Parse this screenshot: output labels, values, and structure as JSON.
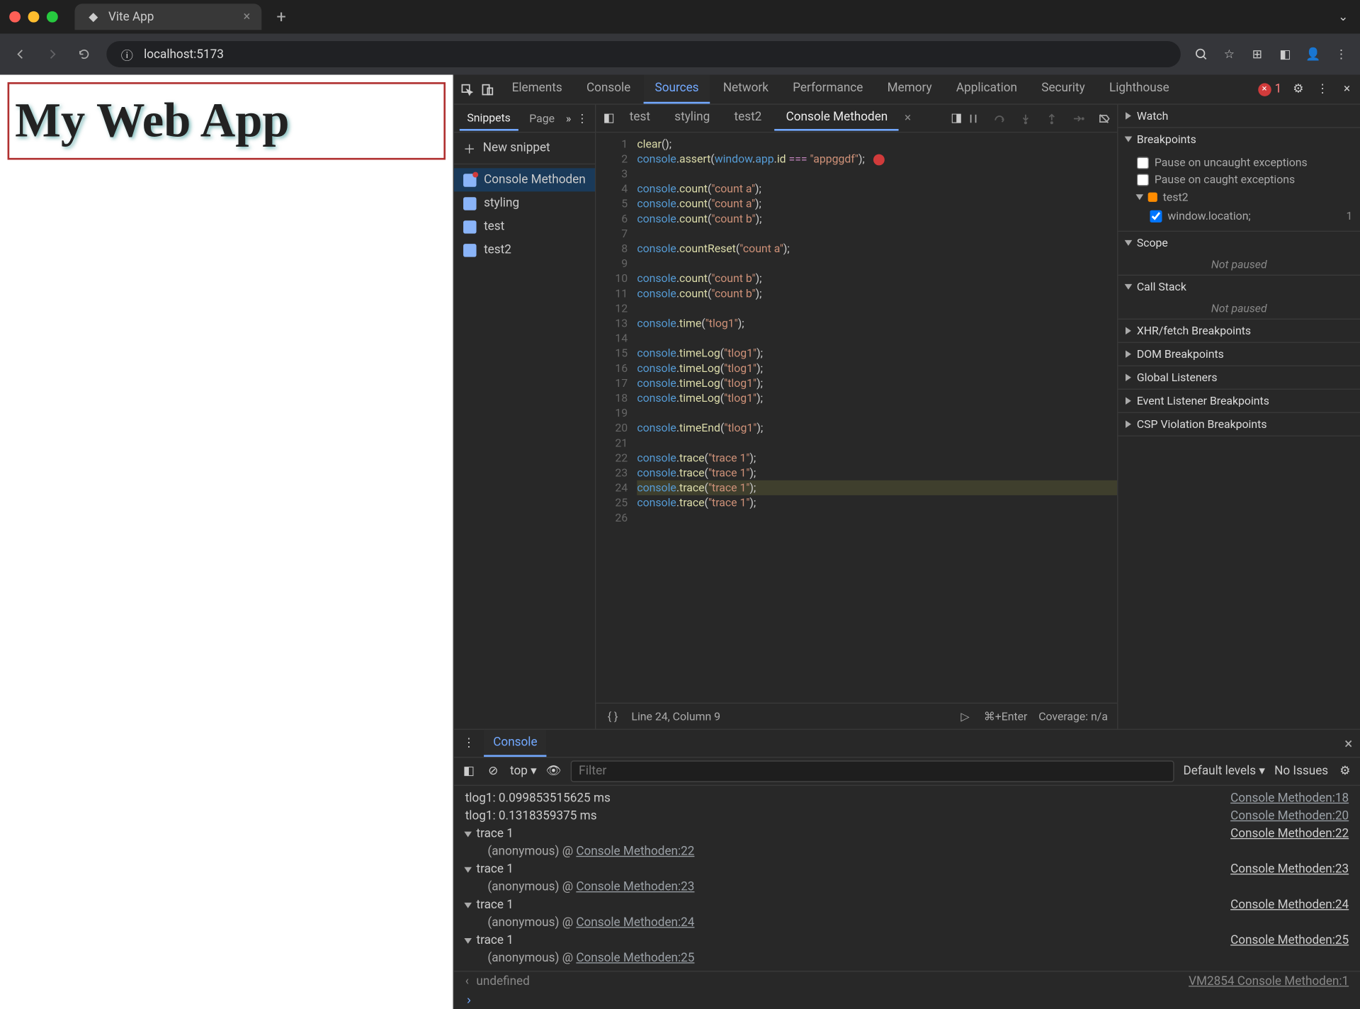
{
  "browser": {
    "tab_title": "Vite App",
    "url": "localhost:5173"
  },
  "page": {
    "heading": "My Web App"
  },
  "devtools": {
    "tabs": [
      "Elements",
      "Console",
      "Sources",
      "Network",
      "Performance",
      "Memory",
      "Application",
      "Security",
      "Lighthouse"
    ],
    "active_tab": "Sources",
    "error_count": "1"
  },
  "sources": {
    "left_tabs": {
      "snippets": "Snippets",
      "page": "Page"
    },
    "new_snippet": "New snippet",
    "snippets": [
      {
        "name": "Console Methoden",
        "selected": true,
        "dirty": true
      },
      {
        "name": "styling",
        "selected": false
      },
      {
        "name": "test",
        "selected": false
      },
      {
        "name": "test2",
        "selected": false
      }
    ],
    "editor_tabs": [
      "test",
      "styling",
      "test2",
      "Console Methoden"
    ],
    "editor_active": "Console Methoden",
    "code": [
      {
        "n": 1,
        "t": "clear();"
      },
      {
        "n": 2,
        "t": "console.assert(window.app.id === \"appggdf\");",
        "err": true
      },
      {
        "n": 3,
        "t": ""
      },
      {
        "n": 4,
        "t": "console.count(\"count a\");"
      },
      {
        "n": 5,
        "t": "console.count(\"count a\");"
      },
      {
        "n": 6,
        "t": "console.count(\"count b\");"
      },
      {
        "n": 7,
        "t": ""
      },
      {
        "n": 8,
        "t": "console.countReset(\"count a\");"
      },
      {
        "n": 9,
        "t": ""
      },
      {
        "n": 10,
        "t": "console.count(\"count b\");"
      },
      {
        "n": 11,
        "t": "console.count(\"count b\");"
      },
      {
        "n": 12,
        "t": ""
      },
      {
        "n": 13,
        "t": "console.time(\"tlog1\");"
      },
      {
        "n": 14,
        "t": ""
      },
      {
        "n": 15,
        "t": "console.timeLog(\"tlog1\");"
      },
      {
        "n": 16,
        "t": "console.timeLog(\"tlog1\");"
      },
      {
        "n": 17,
        "t": "console.timeLog(\"tlog1\");"
      },
      {
        "n": 18,
        "t": "console.timeLog(\"tlog1\");"
      },
      {
        "n": 19,
        "t": ""
      },
      {
        "n": 20,
        "t": "console.timeEnd(\"tlog1\");"
      },
      {
        "n": 21,
        "t": ""
      },
      {
        "n": 22,
        "t": "console.trace(\"trace 1\");"
      },
      {
        "n": 23,
        "t": "console.trace(\"trace 1\");"
      },
      {
        "n": 24,
        "t": "console.trace(\"trace 1\");",
        "hl": true
      },
      {
        "n": 25,
        "t": "console.trace(\"trace 1\");"
      },
      {
        "n": 26,
        "t": ""
      }
    ],
    "status": {
      "pos": "Line 24, Column 9",
      "shortcut": "⌘+Enter",
      "coverage": "Coverage: n/a"
    }
  },
  "debugger": {
    "watch": "Watch",
    "breakpoints": "Breakpoints",
    "pause_uncaught": "Pause on uncaught exceptions",
    "pause_caught": "Pause on caught exceptions",
    "bp_group": "test2",
    "bp_item": "window.location;",
    "bp_line": "1",
    "scope": "Scope",
    "not_paused": "Not paused",
    "call_stack": "Call Stack",
    "xhr": "XHR/fetch Breakpoints",
    "dom": "DOM Breakpoints",
    "global": "Global Listeners",
    "event": "Event Listener Breakpoints",
    "csp": "CSP Violation Breakpoints"
  },
  "console": {
    "tab": "Console",
    "context": "top",
    "filter_placeholder": "Filter",
    "levels": "Default levels",
    "no_issues": "No Issues",
    "logs": [
      {
        "type": "log",
        "msg": "tlog1: 0.099853515625 ms",
        "src": "Console Methoden:18"
      },
      {
        "type": "log",
        "msg": "tlog1: 0.1318359375 ms",
        "src": "Console Methoden:20"
      },
      {
        "type": "trace",
        "label": "trace 1",
        "src": "Console Methoden:22",
        "stack": "(anonymous) @ Console Methoden:22"
      },
      {
        "type": "trace",
        "label": "trace 1",
        "src": "Console Methoden:23",
        "stack": "(anonymous) @ Console Methoden:23"
      },
      {
        "type": "trace",
        "label": "trace 1",
        "src": "Console Methoden:24",
        "stack": "(anonymous) @ Console Methoden:24"
      },
      {
        "type": "trace",
        "label": "trace 1",
        "src": "Console Methoden:25",
        "stack": "(anonymous) @ Console Methoden:25"
      }
    ],
    "return_val": "undefined",
    "return_src": "VM2854 Console Methoden:1"
  }
}
